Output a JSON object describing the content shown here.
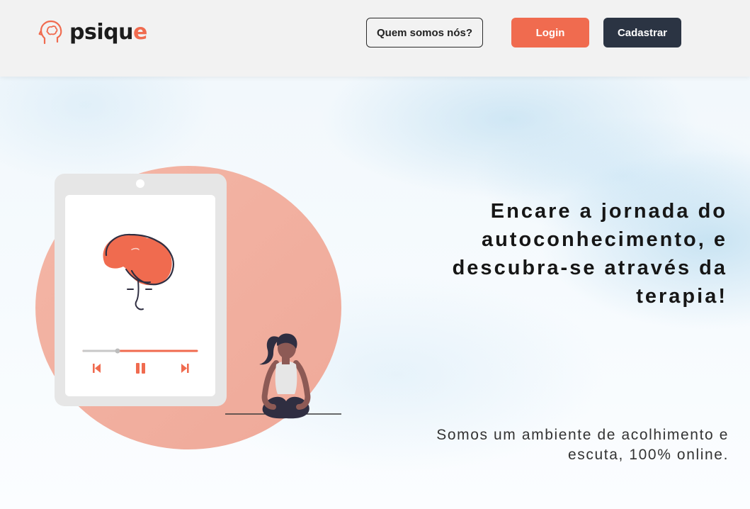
{
  "header": {
    "logo": {
      "prefix": "psiqu",
      "accent": "e"
    },
    "about_label": "Quem somos nós?",
    "login_label": "Login",
    "signup_label": "Cadastrar"
  },
  "hero": {
    "headline": "Encare a jornada do autoconhecimento, e descubra-se através da terapia!",
    "subtext": "Somos um ambiente de acolhimento e escuta, 100% online."
  },
  "player": {
    "progress": 0.3,
    "controls": [
      "skip-previous-icon",
      "pause-icon",
      "skip-next-icon"
    ]
  },
  "colors": {
    "accent": "#f06b4f",
    "dark": "#2b3443",
    "blob": "#f3b4a5",
    "header_bg": "#f2f2f2"
  }
}
